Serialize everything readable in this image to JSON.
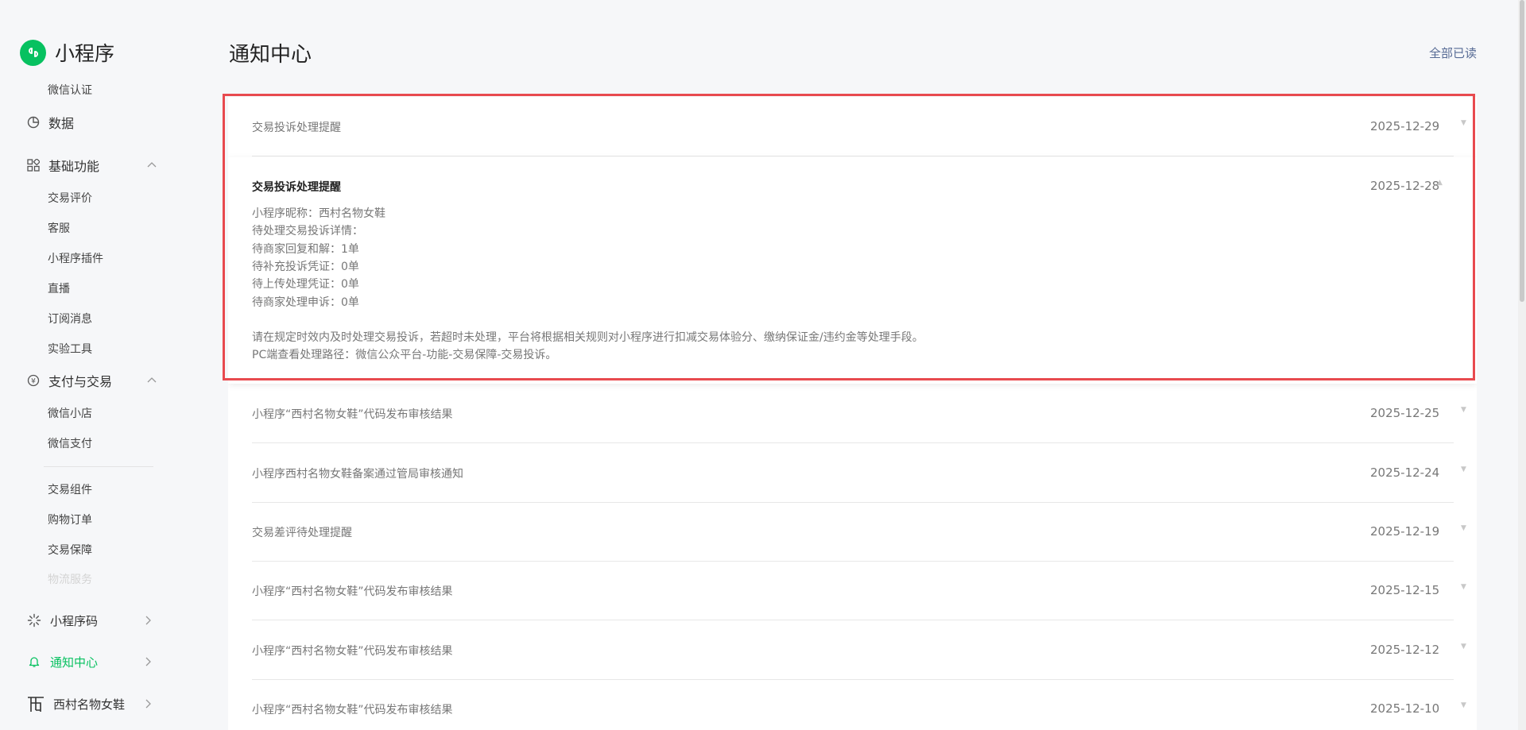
{
  "brand": {
    "name": "小程序"
  },
  "sidebar": {
    "wechat_cert": "微信认证",
    "data": "数据",
    "basic": {
      "label": "基础功能",
      "items": [
        "交易评价",
        "客服",
        "小程序插件",
        "直播",
        "订阅消息",
        "实验工具"
      ]
    },
    "pay": {
      "label": "支付与交易",
      "items": [
        "微信小店",
        "微信支付"
      ],
      "items2": [
        "交易组件",
        "购物订单",
        "交易保障"
      ],
      "faded": "物流服务"
    },
    "qrcode": "小程序码",
    "notice": "通知中心",
    "account": "西村名物女鞋"
  },
  "page": {
    "title": "通知中心",
    "read_all": "全部已读"
  },
  "notifications": [
    {
      "title": "交易投诉处理提醒",
      "date": "2025-12-29"
    },
    {
      "title": "小程序“西村名物女鞋”代码发布审核结果",
      "date": "2025-12-25"
    },
    {
      "title": "小程序西村名物女鞋备案通过管局审核通知",
      "date": "2025-12-24"
    },
    {
      "title": "交易差评待处理提醒",
      "date": "2025-12-19"
    },
    {
      "title": "小程序“西村名物女鞋”代码发布审核结果",
      "date": "2025-12-15"
    },
    {
      "title": "小程序“西村名物女鞋”代码发布审核结果",
      "date": "2025-12-12"
    },
    {
      "title": "小程序“西村名物女鞋”代码发布审核结果",
      "date": "2025-12-10"
    }
  ],
  "expanded": {
    "title": "交易投诉处理提醒",
    "date": "2025-12-28",
    "lines": [
      "小程序昵称：西村名物女鞋",
      "待处理交易投诉详情：",
      "待商家回复和解：1单",
      "待补充投诉凭证：0单",
      "待上传处理凭证：0单",
      "待商家处理申诉：0单"
    ],
    "notes": [
      "请在规定时效内及时处理交易投诉，若超时未处理，平台将根据相关规则对小程序进行扣减交易体验分、缴纳保证金/违约金等处理手段。",
      "PC端查看处理路径：微信公众平台-功能-交易保障-交易投诉。"
    ]
  },
  "colors": {
    "accent": "#07c160",
    "link": "#576b95",
    "highlight": "#e84a4f"
  }
}
